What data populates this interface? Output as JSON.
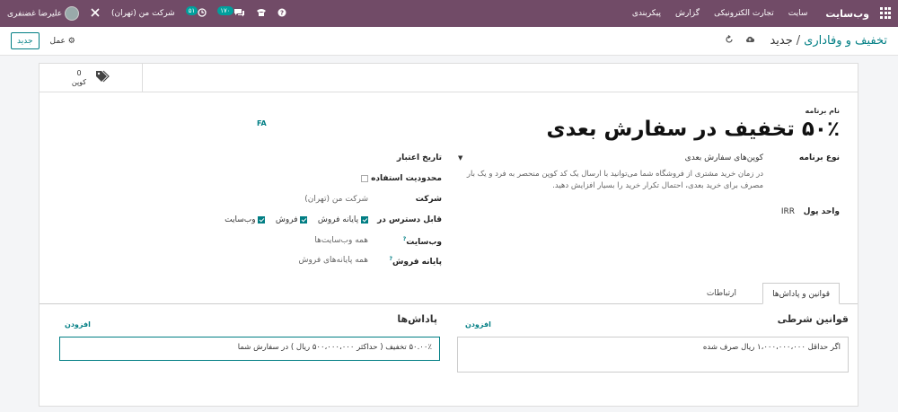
{
  "topbar": {
    "brand": "وب‌سایت",
    "menu": [
      "سایت",
      "تجارت الکترونیکی",
      "گزارش",
      "پیکربندی"
    ],
    "activity_count": "۵۱",
    "messages_count": "۱۷۰",
    "company": "شرکت من (تهران)",
    "user": "علیرضا غضنفری"
  },
  "control": {
    "breadcrumb_parent": "تخفیف و وفاداری",
    "breadcrumb_current": "جدید",
    "action_label": "عمل",
    "new_button": "جدید"
  },
  "smart_button": {
    "count": "0",
    "label": "کوپن"
  },
  "program": {
    "name_label": "نام برنامه",
    "name": "۵۰٪ تخفیف در سفارش بعدی",
    "lang": "FA",
    "type_label": "نوع برنامه",
    "type_value": "کوپن‌های سفارش بعدی",
    "type_help": "در زمان خرید مشتری از فروشگاه شما می‌توانید با ارسال یک کد کوپن منحصر به فرد و یک بار مصرف برای خرید بعدی، احتمال تکرار خرید را بسیار افزایش دهید.",
    "currency_label": "واحد پول",
    "currency_value": "IRR",
    "validity_label": "تاریخ اعتبار",
    "usage_label": "محدودیت استفاده",
    "company_label": "شرکت",
    "company_value": "شرکت من (تهران)",
    "available_label": "قابل دسترس در",
    "available_options": [
      "پایانه فروش",
      "فروش",
      "وب‌سایت"
    ],
    "website_label": "وب‌سایت",
    "website_value": "همه وب‌سایت‌ها",
    "pos_label": "پایانه فروش",
    "pos_value": "همه پایانه‌های فروش",
    "help_mark": "?"
  },
  "tabs": {
    "rules": "قوانین و پاداش‌ها",
    "comms": "ارتباطات"
  },
  "rules": {
    "title": "قوانین شرطی",
    "add": "افزودن",
    "item": "اگر حداقل ۱،۰۰۰،۰۰۰،۰۰۰ ریال صرف شده"
  },
  "rewards": {
    "title": "پاداش‌ها",
    "add": "افزودن",
    "item": "۵۰.۰۰٪ تخفیف ( حداکثر ۵۰۰،۰۰۰،۰۰۰ ریال ) در سفارش شما"
  }
}
